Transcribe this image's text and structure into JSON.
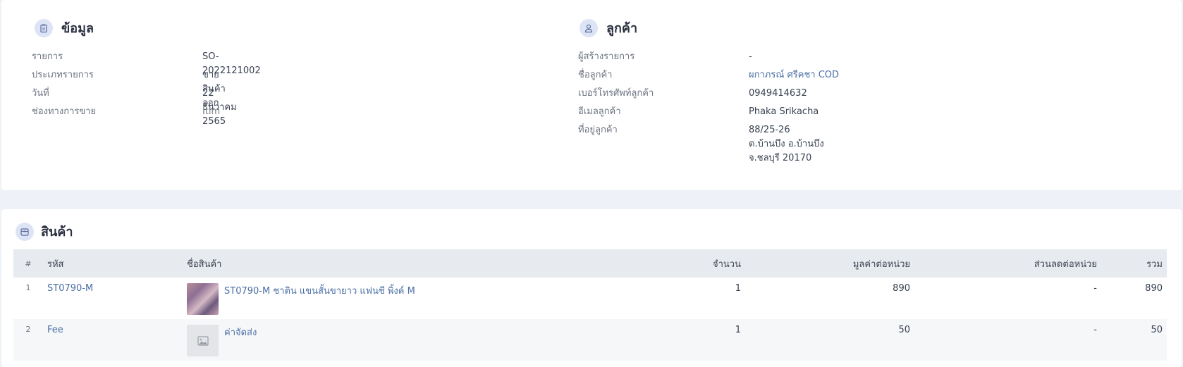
{
  "info": {
    "title": "ข้อมูล",
    "icon": "clipboard-icon",
    "rows": [
      {
        "label": "รายการ",
        "value": "SO-2022121002"
      },
      {
        "label": "ประเภทรายการ",
        "value": "ขายสินค้าออก"
      },
      {
        "label": "วันที่",
        "value": "22 ธันวาคม 2565"
      },
      {
        "label": "ช่องทางการขาย",
        "value": "Itim"
      }
    ]
  },
  "customer": {
    "title": "ลูกค้า",
    "icon": "user-icon",
    "rows": [
      {
        "label": "ผู้สร้างรายการ",
        "value": "-"
      },
      {
        "label": "ชื่อลูกค้า",
        "value": "ผกาภรณ์ ศรีคชา COD"
      },
      {
        "label": "เบอร์โทรศัพท์ลูกค้า",
        "value": "0949414632"
      },
      {
        "label": "อีเมลลูกค้า",
        "value": "Phaka Srikacha"
      },
      {
        "label": "ที่อยู่ลูกค้า",
        "value": "88/25-26\nต.บ้านบึง อ.บ้านบึง\nจ.ชลบุรี 20170"
      }
    ]
  },
  "products": {
    "title": "สินค้า",
    "icon": "box-icon",
    "columns": {
      "idx": "#",
      "code": "รหัส",
      "name": "ชื่อสินค้า",
      "qty": "จำนวน",
      "unit_price": "มูลค่าต่อหน่วย",
      "unit_discount": "ส่วนลดต่อหน่วย",
      "total": "รวม"
    },
    "rows": [
      {
        "idx": "1",
        "code": "ST0790-M",
        "name": "ST0790-M ชาติน แขนสั้นขายาว แฟนซี พิ้งค์ M",
        "qty": "1",
        "unit_price": "890",
        "unit_discount": "-",
        "total": "890",
        "thumb": "product-photo"
      },
      {
        "idx": "2",
        "code": "Fee",
        "name": "ค่าจัดส่ง",
        "qty": "1",
        "unit_price": "50",
        "unit_discount": "-",
        "total": "50",
        "thumb": "image-placeholder-icon"
      }
    ]
  }
}
